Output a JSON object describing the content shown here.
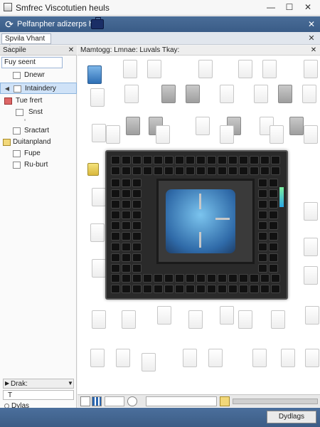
{
  "window": {
    "title": "Smfrec Viscotutien heuls",
    "min": "—",
    "max": "☐",
    "close": "✕"
  },
  "toolbar": {
    "label": "Pelfanpher adizerps hert",
    "refresh_icon": "refresh-icon",
    "briefcase_icon": "briefcase-icon",
    "close": "✕"
  },
  "subbar": {
    "tab": "Spvila Vhant at",
    "close": "✕"
  },
  "sidebar": {
    "header": "Sacpile",
    "close": "✕",
    "items": [
      {
        "label": "Fuy seent"
      },
      {
        "label": "Dnewr"
      },
      {
        "label": "Intaindery"
      },
      {
        "label": "Tue frert"
      },
      {
        "label": "Snst"
      },
      {
        "label": "Sractart"
      },
      {
        "label": "Duitanpland"
      },
      {
        "label": "Fupe"
      },
      {
        "label": "Ru-burt"
      }
    ],
    "bottom": {
      "field1": "Drak:",
      "field2": "T",
      "field3": "Dylas"
    }
  },
  "content": {
    "header": "Mamtogg:  Lmnae:  Luvals Tkay:",
    "close": "✕"
  },
  "statusbar": {
    "button": "Dydlags"
  }
}
